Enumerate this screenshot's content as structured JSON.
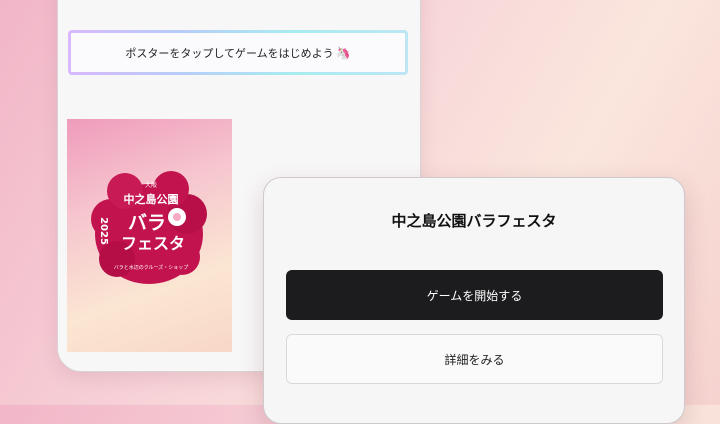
{
  "banner": {
    "text": "ポスターをタップしてゲームをはじめよう",
    "emoji": "🦄"
  },
  "poster": {
    "logo_text": "大阪",
    "title_line1": "中之島公園",
    "year": "2025",
    "title_line2": "バラ",
    "title_line3": "フェスタ",
    "subtitle": "バラと水辺のクルーズ・ショップ",
    "brand_color": "#c2134f"
  },
  "card": {
    "title": "中之島公園バラフェスタ",
    "start_button": "ゲームを開始する",
    "details_button": "詳細をみる"
  }
}
